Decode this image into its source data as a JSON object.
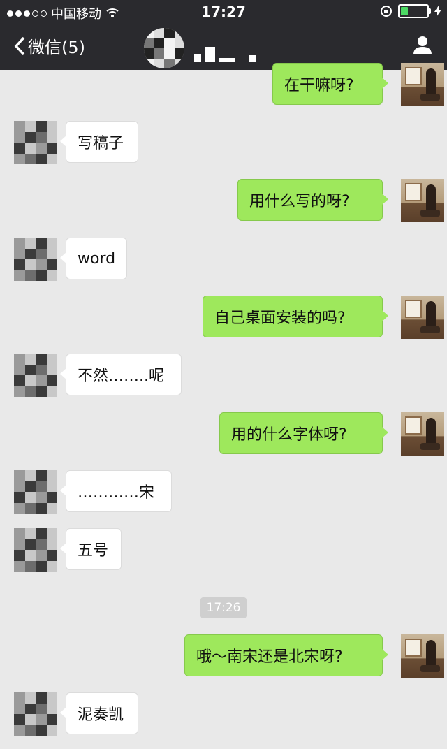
{
  "status_bar": {
    "carrier": "中国移动",
    "time": "17:27"
  },
  "nav": {
    "back_label": "微信(5)",
    "title": "_ ."
  },
  "messages": [
    {
      "side": "out",
      "text": "在干嘛呀?"
    },
    {
      "side": "in",
      "text": "写稿子"
    },
    {
      "side": "out",
      "text": "用什么写的呀?"
    },
    {
      "side": "in",
      "text": "word"
    },
    {
      "side": "out",
      "text": "自己桌面安装的吗?"
    },
    {
      "side": "in",
      "text": "不然……..呢"
    },
    {
      "side": "out",
      "text": "用的什么字体呀?"
    },
    {
      "side": "in",
      "text": "…………宋"
    },
    {
      "side": "in",
      "text": "五号"
    },
    {
      "side": "out",
      "text": "哦～南宋还是北宋呀?"
    },
    {
      "side": "in",
      "text": "泥奏凯"
    }
  ],
  "timestamp": "17:26",
  "colors": {
    "bar": "#2a2a2e",
    "outgoing_bubble": "#9ee85c",
    "incoming_bubble": "#ffffff",
    "chat_background": "#e9e9e9"
  }
}
